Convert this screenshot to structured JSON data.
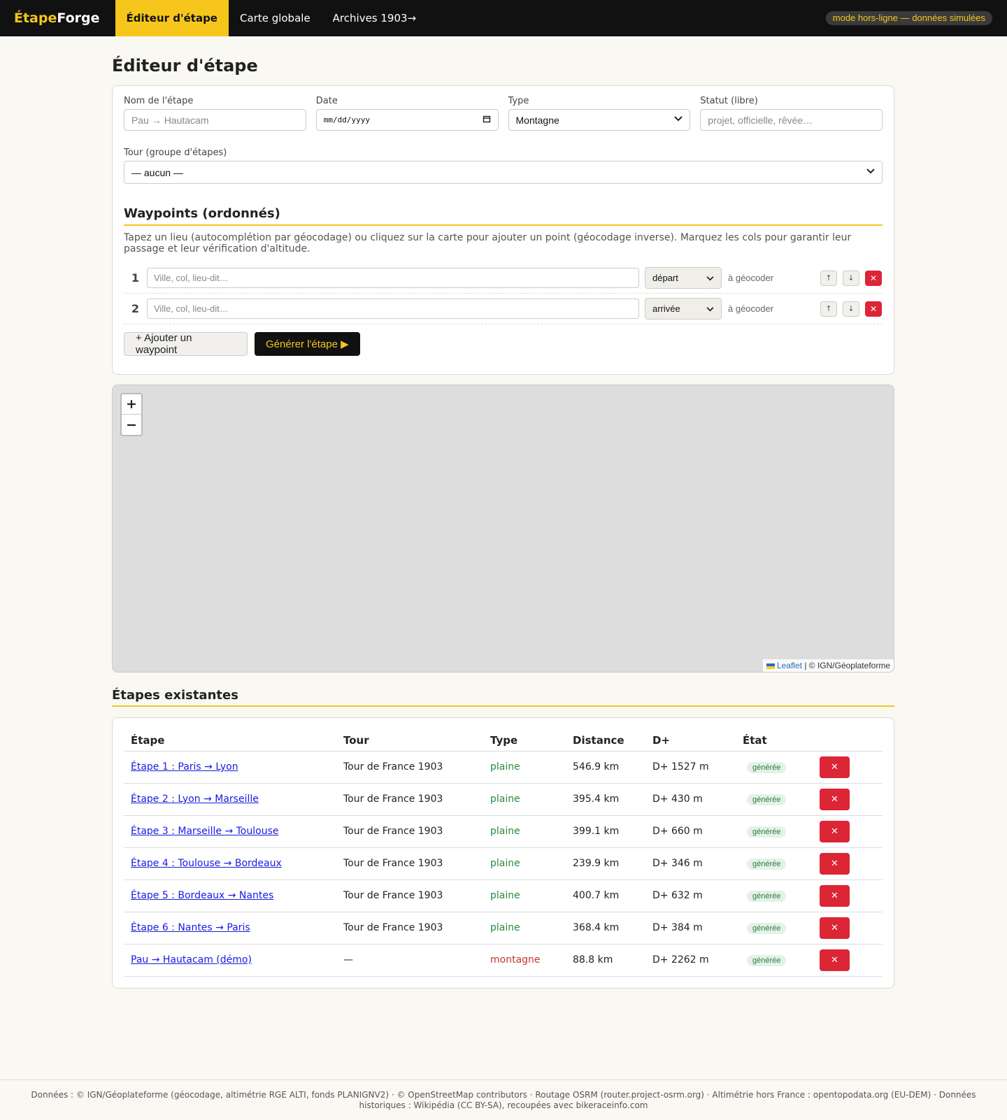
{
  "nav": {
    "brand_part1": "Étape",
    "brand_part2": "Forge",
    "links": [
      "Éditeur d'étape",
      "Carte globale",
      "Archives 1903→"
    ],
    "mode_badge": "mode hors-ligne — données simulées"
  },
  "page_title": "Éditeur d'étape",
  "form": {
    "name_label": "Nom de l'étape",
    "name_placeholder": "Pau → Hautacam",
    "date_label": "Date",
    "date_placeholder": "mm/dd/yyyy",
    "type_label": "Type",
    "type_value": "Montagne",
    "status_label": "Statut (libre)",
    "status_placeholder": "projet, officielle, rêvée…",
    "tour_label": "Tour (groupe d'étapes)",
    "tour_value": "— aucun —"
  },
  "waypoints": {
    "title": "Waypoints (ordonnés)",
    "help": "Tapez un lieu (autocomplétion par géocodage) ou cliquez sur la carte pour ajouter un point (géocodage inverse). Marquez les cols pour garantir leur passage et leur vérification d'altitude.",
    "rows": [
      {
        "num": "1",
        "placeholder": "Ville, col, lieu-dit…",
        "type": "départ",
        "status": "à géocoder"
      },
      {
        "num": "2",
        "placeholder": "Ville, col, lieu-dit…",
        "type": "arrivée",
        "status": "à géocoder"
      }
    ],
    "up_label": "↑",
    "down_label": "↓",
    "remove_label": "✕",
    "add_label": "+ Ajouter un waypoint",
    "generate_label": "Générer l'étape ▶"
  },
  "map": {
    "zoom_in": "+",
    "zoom_out": "−",
    "attrib_leaflet": "Leaflet",
    "attrib_rest": " | © IGN/Géoplateforme"
  },
  "stages": {
    "title": "Étapes existantes",
    "headers": [
      "Étape",
      "Tour",
      "Type",
      "Distance",
      "D+",
      "État",
      ""
    ],
    "delete_label": "✕",
    "rows": [
      {
        "name": "Étape 1 : Paris → Lyon",
        "tour": "Tour de France 1903",
        "type": "plaine",
        "distance": "546.9 km",
        "dplus": "D+ 1527 m",
        "state": "générée"
      },
      {
        "name": "Étape 2 : Lyon → Marseille",
        "tour": "Tour de France 1903",
        "type": "plaine",
        "distance": "395.4 km",
        "dplus": "D+ 430 m",
        "state": "générée"
      },
      {
        "name": "Étape 3 : Marseille → Toulouse",
        "tour": "Tour de France 1903",
        "type": "plaine",
        "distance": "399.1 km",
        "dplus": "D+ 660 m",
        "state": "générée"
      },
      {
        "name": "Étape 4 : Toulouse → Bordeaux",
        "tour": "Tour de France 1903",
        "type": "plaine",
        "distance": "239.9 km",
        "dplus": "D+ 346 m",
        "state": "générée"
      },
      {
        "name": "Étape 5 : Bordeaux → Nantes",
        "tour": "Tour de France 1903",
        "type": "plaine",
        "distance": "400.7 km",
        "dplus": "D+ 632 m",
        "state": "générée"
      },
      {
        "name": "Étape 6 : Nantes → Paris",
        "tour": "Tour de France 1903",
        "type": "plaine",
        "distance": "368.4 km",
        "dplus": "D+ 384 m",
        "state": "générée"
      },
      {
        "name": "Pau → Hautacam (démo)",
        "tour": "—",
        "type": "montagne",
        "distance": "88.8 km",
        "dplus": "D+ 2262 m",
        "state": "générée"
      }
    ]
  },
  "footer": "Données : © IGN/Géoplateforme (géocodage, altimétrie RGE ALTI, fonds PLANIGNV2) · © OpenStreetMap contributors · Routage OSRM (router.project-osrm.org) · Altimétrie hors France : opentopodata.org (EU-DEM) · Données historiques : Wikipédia (CC BY-SA), recoupées avec bikeraceinfo.com"
}
